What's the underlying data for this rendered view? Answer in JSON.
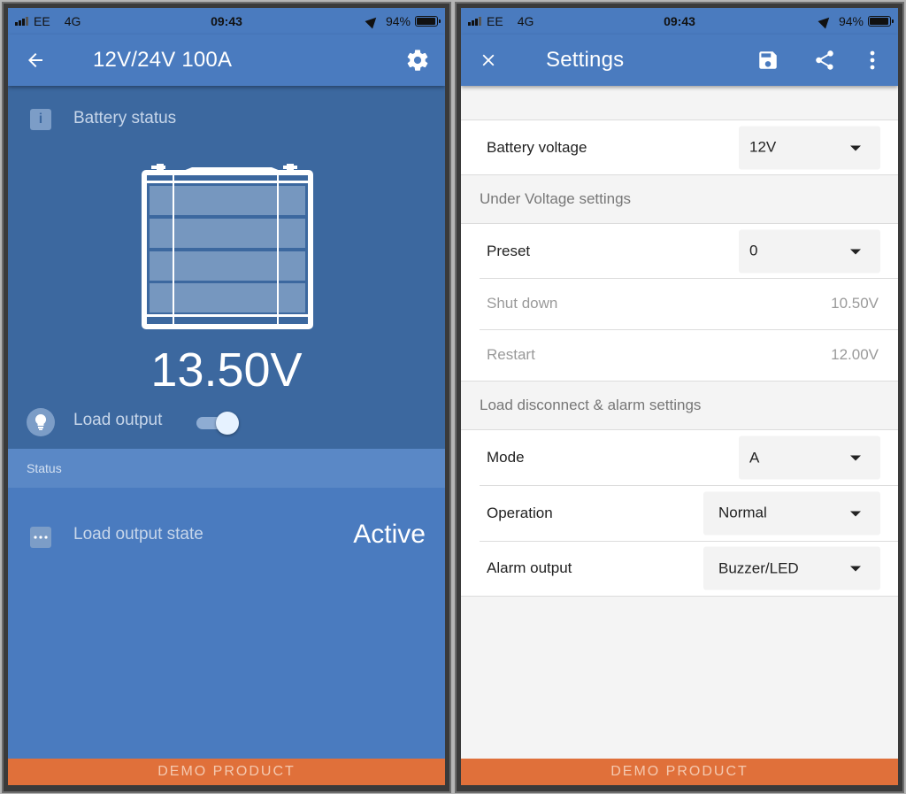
{
  "status_bar": {
    "carrier": "EE",
    "network": "4G",
    "time": "09:43",
    "battery_percent": "94%",
    "battery_level": 0.94
  },
  "left_screen": {
    "header": {
      "title": "12V/24V 100A",
      "back_icon": "arrow-left-icon",
      "settings_icon": "gear-icon"
    },
    "battery_status": {
      "label": "Battery status",
      "icon": "info-icon",
      "voltage": "13.50V"
    },
    "load_output": {
      "label": "Load output",
      "icon": "lightbulb-icon",
      "enabled": true
    },
    "status_section": {
      "title": "Status",
      "rows": [
        {
          "label": "Load output state",
          "value": "Active",
          "icon": "more-dots-icon"
        }
      ]
    },
    "footer": "DEMO PRODUCT"
  },
  "right_screen": {
    "header": {
      "title": "Settings",
      "close_icon": "close-icon",
      "save_icon": "save-icon",
      "share_icon": "share-icon",
      "more_icon": "more-vertical-icon"
    },
    "battery_voltage": {
      "label": "Battery voltage",
      "value": "12V"
    },
    "under_voltage": {
      "title": "Under Voltage settings",
      "preset": {
        "label": "Preset",
        "value": "0"
      },
      "shut_down": {
        "label": "Shut down",
        "value": "10.50V"
      },
      "restart": {
        "label": "Restart",
        "value": "12.00V"
      }
    },
    "load_disconnect": {
      "title": "Load disconnect & alarm settings",
      "mode": {
        "label": "Mode",
        "value": "A"
      },
      "operation": {
        "label": "Operation",
        "value": "Normal"
      },
      "alarm_output": {
        "label": "Alarm output",
        "value": "Buzzer/LED"
      }
    },
    "footer": "DEMO PRODUCT"
  },
  "colors": {
    "primary": "#4a7bbf",
    "primary_dark": "#3c689f",
    "section_header": "#5a88c6",
    "demo_banner": "#e0703a"
  }
}
